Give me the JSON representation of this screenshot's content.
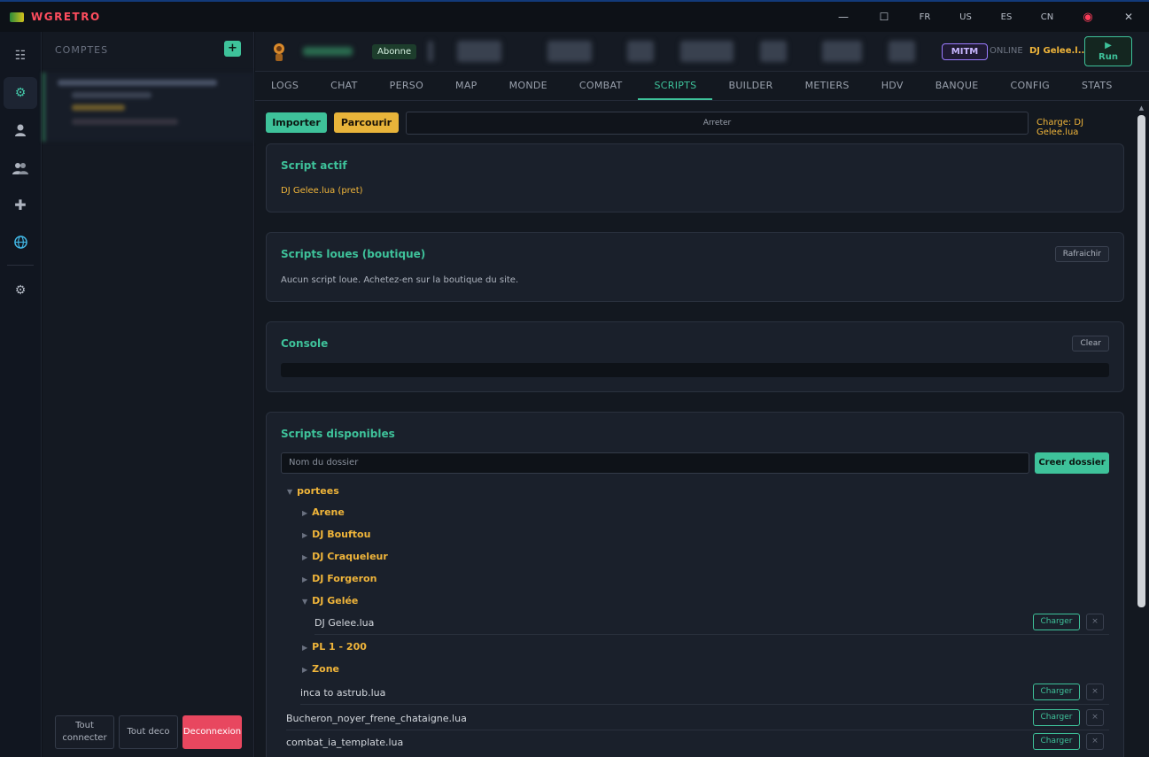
{
  "app": {
    "title": "WGRETRO"
  },
  "window_controls": {
    "minimize": "—",
    "maximize": "☐",
    "close": "✕",
    "langs": [
      "FR",
      "US",
      "ES",
      "CN"
    ]
  },
  "rail": {
    "icons": [
      "list-icon",
      "gear-icon",
      "user-icon",
      "users-icon",
      "plus-icon",
      "globe-icon",
      "settings-icon"
    ]
  },
  "accounts": {
    "title": "COMPTES",
    "add_label": "+",
    "footer": {
      "connect_all": "Tout connecter",
      "disconnect_all": "Tout deco",
      "logout": "Deconnexion"
    }
  },
  "header": {
    "subscription": "Abonne",
    "mitm": "MITM",
    "status": "ONLINE",
    "current_script": "DJ Gelee.l...",
    "run_icon": "▶",
    "run_label": "Run"
  },
  "tabs": [
    "LOGS",
    "CHAT",
    "PERSO",
    "MAP",
    "MONDE",
    "COMBAT",
    "SCRIPTS",
    "BUILDER",
    "METIERS",
    "HDV",
    "BANQUE",
    "CONFIG",
    "STATS"
  ],
  "active_tab": "SCRIPTS",
  "toolbar": {
    "import_label": "Importer",
    "browse_label": "Parcourir",
    "stop_label": "Arreter",
    "loaded_text": "Charge: DJ Gelee.lua"
  },
  "active_script": {
    "title": "Script actif",
    "value": "DJ Gelee.lua (pret)"
  },
  "rented": {
    "title": "Scripts loues (boutique)",
    "refresh_label": "Rafraichir",
    "empty_text": "Aucun script loue. Achetez-en sur la boutique du site."
  },
  "console": {
    "title": "Console",
    "clear_label": "Clear"
  },
  "available": {
    "title": "Scripts disponibles",
    "folder_placeholder": "Nom du dossier",
    "create_label": "Creer dossier",
    "load_label": "Charger",
    "delete_label": "×",
    "tree": {
      "root": "portees",
      "folders": [
        "Arene",
        "DJ Bouftou",
        "DJ Craqueleur",
        "DJ Forgeron",
        "DJ Gelée"
      ],
      "gelee_file": "DJ Gelee.lua",
      "folders2": [
        "PL 1 - 200",
        "Zone"
      ],
      "root_file": "inca to astrub.lua",
      "top_files": [
        "Bucheron_noyer_frene_chataigne.lua",
        "combat_ia_template.lua"
      ]
    }
  }
}
